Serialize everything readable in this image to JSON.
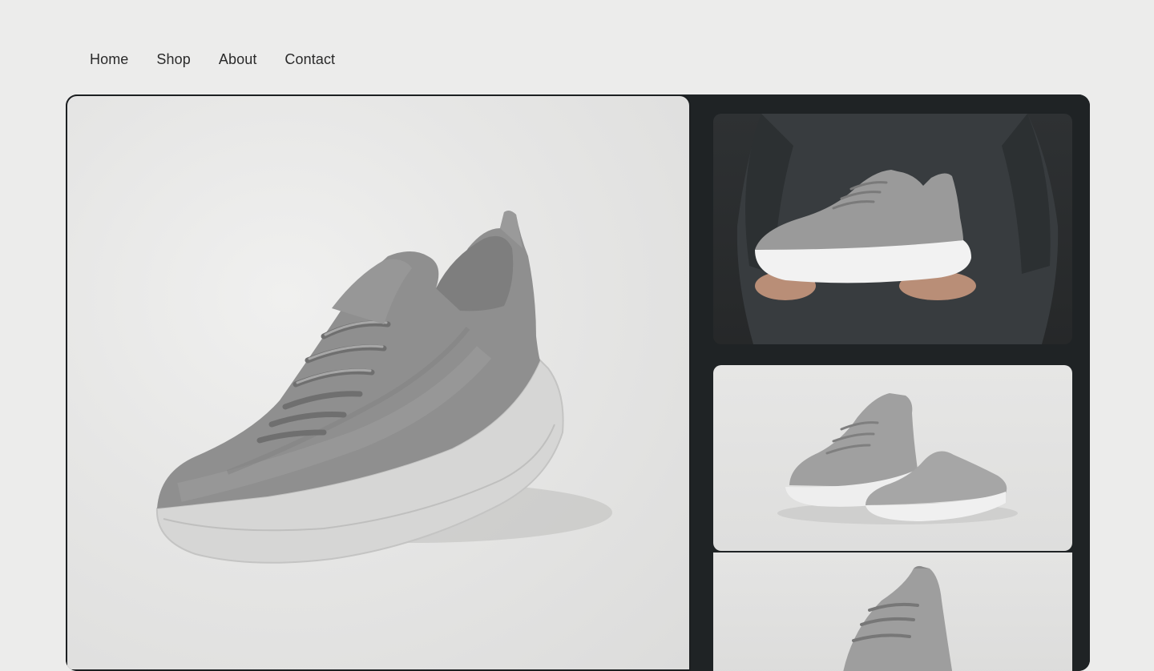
{
  "nav": {
    "items": [
      {
        "label": "Home"
      },
      {
        "label": "Shop"
      },
      {
        "label": "About"
      },
      {
        "label": "Contact"
      }
    ]
  },
  "product": {
    "gallery": {
      "main_image": "grey-knit-running-shoe-side-view",
      "thumbnails": [
        "shoe-held-in-hands",
        "shoe-pair-stacked",
        "shoe-top-view"
      ]
    }
  },
  "colors": {
    "page_background": "#ececeb",
    "gallery_frame": "#1f2325",
    "shoe_upper": "#8e8e8e",
    "shoe_sole": "#dcdcdc"
  }
}
